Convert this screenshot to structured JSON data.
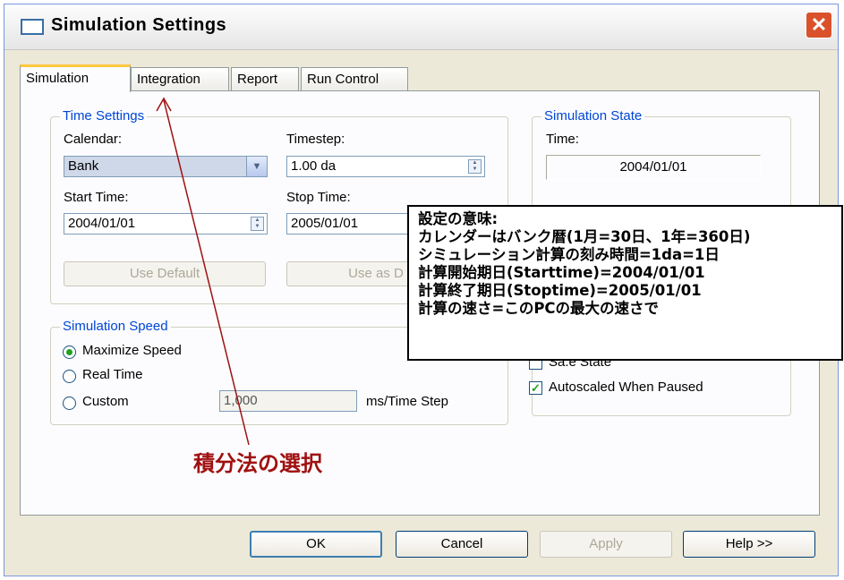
{
  "window": {
    "title": "Simulation Settings",
    "close_glyph": "✕"
  },
  "tabs": [
    {
      "label": "Simulation",
      "active": true
    },
    {
      "label": "Integration",
      "active": false
    },
    {
      "label": "Report",
      "active": false
    },
    {
      "label": "Run Control",
      "active": false
    }
  ],
  "time_settings": {
    "title": "Time Settings",
    "calendar_label": "Calendar:",
    "calendar_value": "Bank",
    "timestep_label": "Timestep:",
    "timestep_value": "1.00 da",
    "start_label": "Start Time:",
    "start_value": "2004/01/01",
    "stop_label": "Stop Time:",
    "stop_value": "2005/01/01",
    "use_default_label": "Use Default",
    "use_as_default_label": "Use as D"
  },
  "simulation_state": {
    "title": "Simulation State",
    "time_label": "Time:",
    "time_value": "2004/01/01",
    "partial_label": "Sa.e State",
    "autoscaled_label": "Autoscaled When Paused"
  },
  "simulation_speed": {
    "title": "Simulation Speed",
    "options": [
      {
        "label": "Maximize Speed",
        "selected": true
      },
      {
        "label": "Real Time",
        "selected": false
      },
      {
        "label": "Custom",
        "selected": false
      }
    ],
    "custom_value": "1,000",
    "unit_label": "ms/Time Step"
  },
  "buttons": {
    "ok": "OK",
    "cancel": "Cancel",
    "apply": "Apply",
    "help": "Help >>"
  },
  "callout": {
    "lines": [
      "設定の意味:",
      "カレンダーはバンク暦(1月=30日、1年=360日)",
      "シミュレーション計算の刻み時間=1da=1日",
      "計算開始期日(Starttime)=2004/01/01",
      "計算終了期日(Stoptime)=2005/01/01",
      "計算の速さ=このPCの最大の速さで"
    ]
  },
  "annotation": "積分法の選択",
  "colors": {
    "group_title": "#0046d5",
    "annotation": "#a01010",
    "active_tab_accent": "#ffc83c"
  }
}
